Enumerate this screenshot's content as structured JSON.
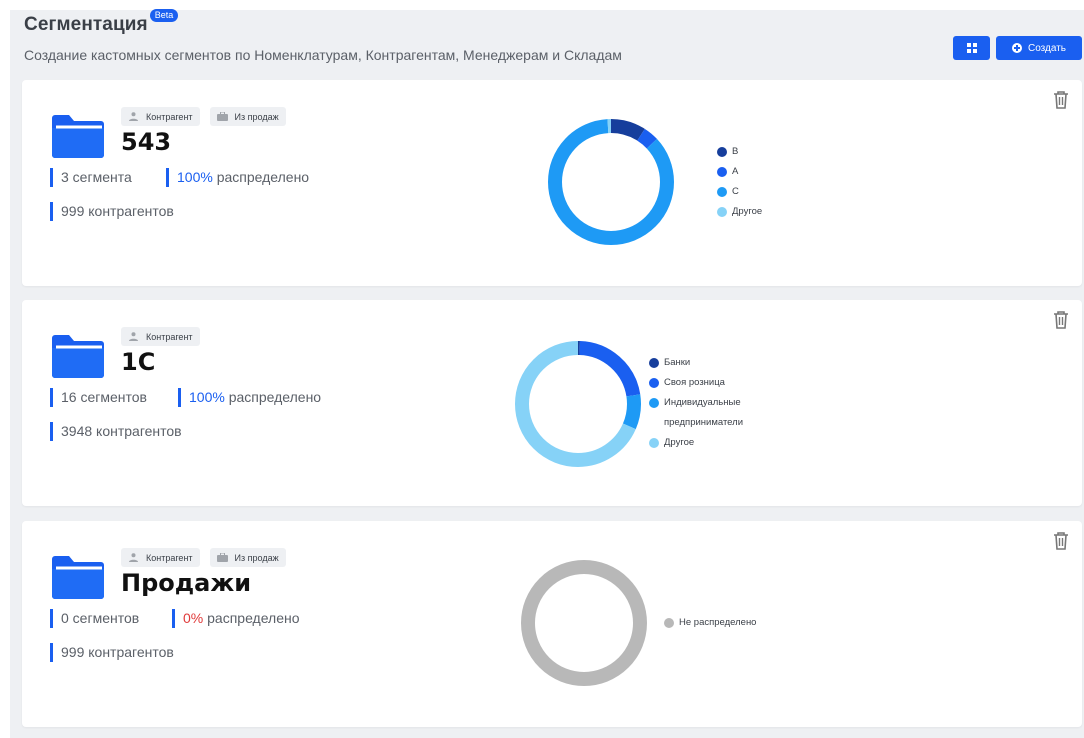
{
  "header": {
    "title": "Сегментация",
    "beta": "Beta",
    "subtitle": "Создание кастомных сегментов по Номенклатурам, Контрагентам, Менеджерам и Складам"
  },
  "toolbar": {
    "grid_icon": "grid-icon",
    "create_label": "Создать",
    "create_icon": "plus-circle-icon"
  },
  "colors": {
    "accent": "#1a5ff0",
    "dark_blue": "#163e9c",
    "blue": "#1a5ff0",
    "sky": "#1e9af5",
    "light": "#86d2f7",
    "gray": "#b8b8b8",
    "red": "#e03a3a"
  },
  "cards": [
    {
      "name": "543",
      "tags": [
        {
          "icon": "user-icon",
          "label": "Контрагент"
        },
        {
          "icon": "briefcase-icon",
          "label": "Из продаж"
        }
      ],
      "segments": "3 сегмента",
      "distributed_value": "100%",
      "distributed_label": "распределено",
      "counterparties": "999 контрагентов",
      "legend": [
        {
          "label": "B",
          "color": "#163e9c"
        },
        {
          "label": "A",
          "color": "#1a5ff0"
        },
        {
          "label": "C",
          "color": "#1e9af5"
        },
        {
          "label": "Другое",
          "color": "#86d2f7"
        }
      ],
      "donut_fractions": [
        0.09,
        0.04,
        0.86,
        0.01
      ]
    },
    {
      "name": "1С",
      "tags": [
        {
          "icon": "user-icon",
          "label": "Контрагент"
        }
      ],
      "segments": "16 сегментов",
      "distributed_value": "100%",
      "distributed_label": "распределено",
      "counterparties": "3948 контрагентов",
      "legend": [
        {
          "label": "Банки",
          "color": "#163e9c"
        },
        {
          "label": "Своя розница",
          "color": "#1a5ff0"
        },
        {
          "label": "Индивидуальные предприниматели",
          "color": "#1e9af5"
        },
        {
          "label": "Другое",
          "color": "#86d2f7"
        }
      ],
      "donut_fractions": [
        0.005,
        0.22,
        0.09,
        0.685
      ]
    },
    {
      "name": "Продажи",
      "tags": [
        {
          "icon": "user-icon",
          "label": "Контрагент"
        },
        {
          "icon": "briefcase-icon",
          "label": "Из продаж"
        }
      ],
      "segments": "0 сегментов",
      "distributed_value": "0%",
      "distributed_label": "распределено",
      "counterparties": "999 контрагентов",
      "legend": [
        {
          "label": "Не распределено",
          "color": "#b8b8b8"
        }
      ],
      "donut_fractions": [
        1
      ]
    }
  ]
}
